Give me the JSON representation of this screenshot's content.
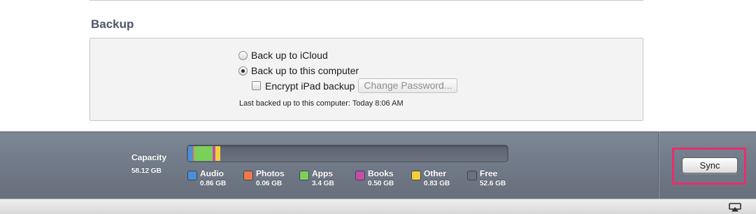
{
  "backup": {
    "title": "Backup",
    "options": {
      "icloud": "Back up to iCloud",
      "computer": "Back up to this computer",
      "encrypt": "Encrypt iPad backup",
      "change_password": "Change Password..."
    },
    "selected": "computer",
    "encrypt_checked": false,
    "last_backup": "Last backed up to this computer: Today 8:06 AM"
  },
  "capacity": {
    "label": "Capacity",
    "total": "58.12 GB",
    "total_gb": 58.12,
    "categories": [
      {
        "name": "Audio",
        "size": "0.86 GB",
        "gb": 0.86,
        "color": "#4a90d9"
      },
      {
        "name": "Photos",
        "size": "0.06 GB",
        "gb": 0.06,
        "color": "#f0784a"
      },
      {
        "name": "Apps",
        "size": "3.4 GB",
        "gb": 3.4,
        "color": "#7ad15a"
      },
      {
        "name": "Books",
        "size": "0.50 GB",
        "gb": 0.5,
        "color": "#c24fa6"
      },
      {
        "name": "Other",
        "size": "0.83 GB",
        "gb": 0.83,
        "color": "#f2cf3a"
      },
      {
        "name": "Free",
        "size": "52.6 GB",
        "gb": 52.6,
        "color": "#6a707d"
      }
    ]
  },
  "sync_label": "Sync",
  "icons": {
    "airplay": "airplay-icon"
  }
}
